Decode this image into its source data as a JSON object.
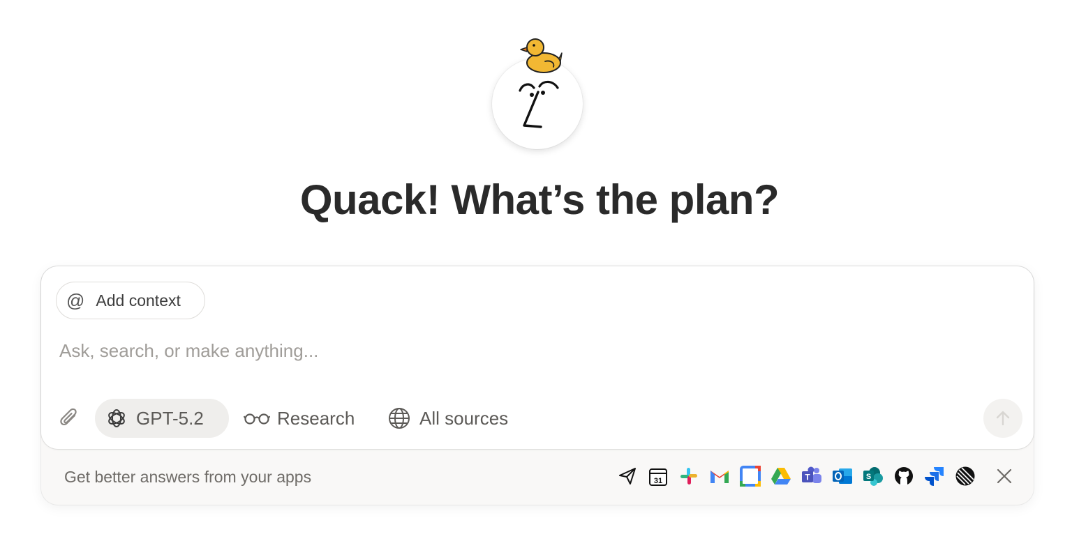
{
  "hero": {
    "title": "Quack! What’s the plan?"
  },
  "composer": {
    "add_context_label": "Add context",
    "add_context_icon": "@",
    "input_placeholder": "Ask, search, or make anything...",
    "input_value": "",
    "model_label": "GPT-5.2",
    "research_label": "Research",
    "sources_label": "All sources"
  },
  "apps_bar": {
    "text": "Get better answers from your apps",
    "apps": [
      "send-icon",
      "calendar-icon",
      "slack-icon",
      "gmail-icon",
      "google-calendar-icon",
      "google-drive-icon",
      "teams-icon",
      "outlook-icon",
      "sharepoint-icon",
      "github-icon",
      "jira-icon",
      "linear-icon"
    ],
    "calendar_day": "31"
  },
  "colors": {
    "duck": "#f2b833",
    "accent_grey": "#5c5a57",
    "footer_bg": "#f9f8f7"
  }
}
